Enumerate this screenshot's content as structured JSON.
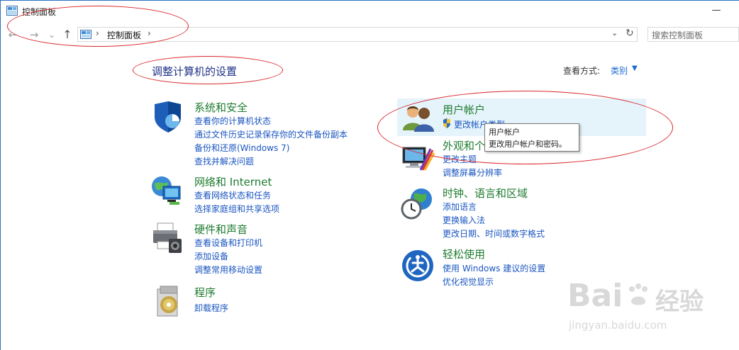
{
  "window": {
    "title": "控制面板",
    "minimize_glyph": "—"
  },
  "nav": {
    "back_icon": "←",
    "forward_icon": "→",
    "recent_icon": "⌄",
    "up_icon": "↑",
    "address": "控制面板",
    "separator": "›",
    "search_placeholder": "搜索控制面板"
  },
  "main": {
    "heading": "调整计算机的设置",
    "view_by_label": "查看方式:",
    "view_by_value": "类别",
    "categories": [
      {
        "title": "系统和安全",
        "links": [
          "查看你的计算机状态",
          "通过文件历史记录保存你的文件备份副本",
          "备份和还原(Windows 7)",
          "查找并解决问题"
        ],
        "icon": "shield-icon"
      },
      {
        "title": "网络和 Internet",
        "links": [
          "查看网络状态和任务",
          "选择家庭组和共享选项"
        ],
        "icon": "network-globe-icon"
      },
      {
        "title": "硬件和声音",
        "links": [
          "查看设备和打印机",
          "添加设备",
          "调整常用移动设置"
        ],
        "icon": "printer-icon"
      },
      {
        "title": "程序",
        "links": [
          "卸载程序"
        ],
        "icon": "programs-disc-icon"
      },
      {
        "title": "用户帐户",
        "links": [
          "更改帐户类型"
        ],
        "icon": "users-icon"
      },
      {
        "title": "外观和个性化",
        "links": [
          "更改主题",
          "调整屏幕分辨率"
        ],
        "icon": "appearance-monitor-icon"
      },
      {
        "title": "时钟、语言和区域",
        "links": [
          "添加语言",
          "更换输入法",
          "更改日期、时间或数字格式"
        ],
        "icon": "clock-globe-icon"
      },
      {
        "title": "轻松使用",
        "links": [
          "使用 Windows 建议的设置",
          "优化视觉显示"
        ],
        "icon": "ease-of-access-icon"
      }
    ],
    "tooltip": {
      "line1": "用户帐户",
      "line2": "更改用户帐户和密码。"
    }
  },
  "watermark": {
    "brand": "Bai",
    "brand_cn": "经验",
    "url": "jingyan.baidu.com"
  },
  "colors": {
    "link": "#1a56c0",
    "category_title": "#1e7b2f",
    "heading": "#1e3287",
    "annotation": "#d9262b",
    "highlight": "#e5f3fb"
  }
}
